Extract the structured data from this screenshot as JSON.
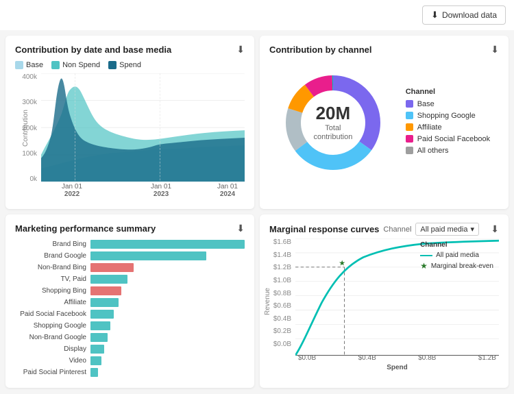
{
  "topbar": {
    "download_label": "Download data"
  },
  "card1": {
    "title": "Contribution by date and base media",
    "legend": [
      {
        "label": "Base",
        "color": "#a8d8ea"
      },
      {
        "label": "Non Spend",
        "color": "#4fc3c3"
      },
      {
        "label": "Spend",
        "color": "#1a6b8a"
      }
    ],
    "yaxis": [
      "400k",
      "300k",
      "200k",
      "100k",
      "0k"
    ],
    "xaxis": [
      {
        "label": "Jan 01",
        "sublabel": "2022"
      },
      {
        "label": "Jan 01",
        "sublabel": "2023"
      },
      {
        "label": "Jan 01",
        "sublabel": "2024"
      }
    ]
  },
  "card2": {
    "title": "Contribution by channel",
    "donut_value": "20M",
    "donut_label": "Total contribution",
    "legend_title": "Channel",
    "channels": [
      {
        "label": "Base",
        "color": "#7b68ee"
      },
      {
        "label": "Shopping Google",
        "color": "#4fc3f7"
      },
      {
        "label": "Affiliate",
        "color": "#ff9800"
      },
      {
        "label": "Paid Social Facebook",
        "color": "#e91e8c"
      },
      {
        "label": "All others",
        "color": "#9e9e9e"
      }
    ]
  },
  "card3": {
    "title": "Marketing performance summary",
    "bars": [
      {
        "label": "Brand Bing",
        "value": 100,
        "color": "#4fc3c3"
      },
      {
        "label": "Brand Google",
        "value": 75,
        "color": "#4fc3c3"
      },
      {
        "label": "Non-Brand Bing",
        "value": 28,
        "color": "#e57373"
      },
      {
        "label": "TV, Paid",
        "value": 24,
        "color": "#4fc3c3"
      },
      {
        "label": "Shopping Bing",
        "value": 20,
        "color": "#e57373"
      },
      {
        "label": "Affiliate",
        "value": 18,
        "color": "#4fc3c3"
      },
      {
        "label": "Paid Social Facebook",
        "value": 15,
        "color": "#4fc3c3"
      },
      {
        "label": "Shopping Google",
        "value": 13,
        "color": "#4fc3c3"
      },
      {
        "label": "Non-Brand Google",
        "value": 11,
        "color": "#4fc3c3"
      },
      {
        "label": "Display",
        "value": 9,
        "color": "#4fc3c3"
      },
      {
        "label": "Video",
        "value": 7,
        "color": "#4fc3c3"
      },
      {
        "label": "Paid Social Pinterest",
        "value": 5,
        "color": "#4fc3c3"
      }
    ]
  },
  "card4": {
    "title": "Marginal response curves",
    "channel_label": "Channel",
    "channel_value": "All paid media",
    "yaxis": [
      "$1.6B",
      "$1.4B",
      "$1.2B",
      "$1.0B",
      "$0.8B",
      "$0.6B",
      "$0.4B",
      "$0.2B",
      "$0.0B"
    ],
    "xaxis": [
      "$0.0B",
      "$0.4B",
      "$0.8B",
      "$1.2B"
    ],
    "x_title": "Spend",
    "legend_title": "Channel",
    "legend_items": [
      {
        "label": "All paid media",
        "type": "line"
      },
      {
        "label": "Marginal break-even",
        "type": "star"
      }
    ]
  }
}
